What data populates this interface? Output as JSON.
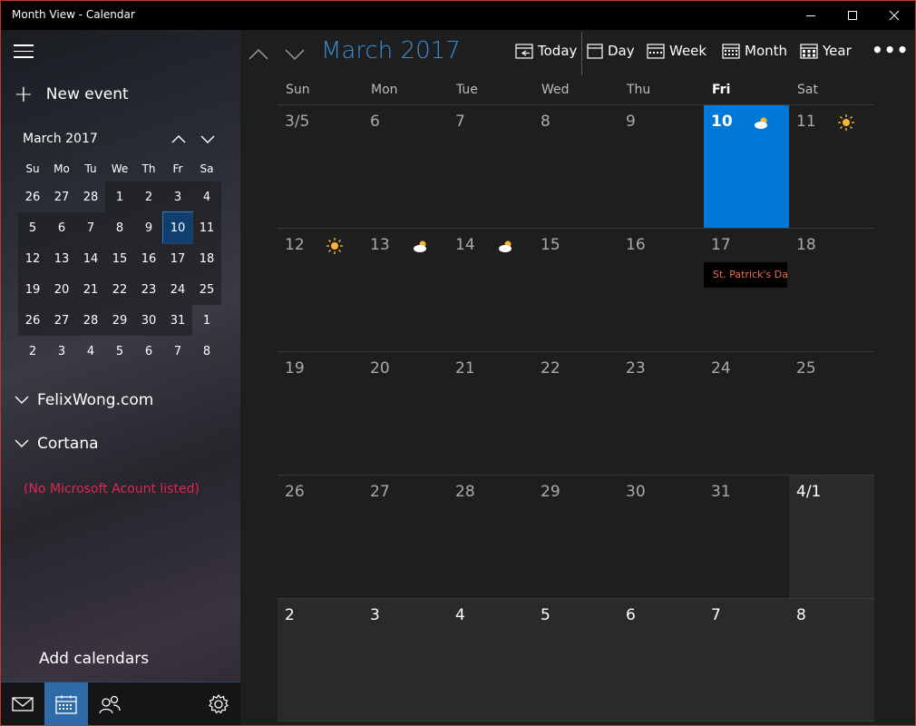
{
  "window": {
    "title": "Month View - Calendar"
  },
  "sidebar": {
    "new_event_label": "New event",
    "mini_month_title": "March 2017",
    "dow": [
      "Su",
      "Mo",
      "Tu",
      "We",
      "Th",
      "Fr",
      "Sa"
    ],
    "weeks": [
      [
        "26",
        "27",
        "28",
        "1",
        "2",
        "3",
        "4"
      ],
      [
        "5",
        "6",
        "7",
        "8",
        "9",
        "10",
        "11"
      ],
      [
        "12",
        "13",
        "14",
        "15",
        "16",
        "17",
        "18"
      ],
      [
        "19",
        "20",
        "21",
        "22",
        "23",
        "24",
        "25"
      ],
      [
        "26",
        "27",
        "28",
        "29",
        "30",
        "31",
        "1"
      ],
      [
        "2",
        "3",
        "4",
        "5",
        "6",
        "7",
        "8"
      ]
    ],
    "accounts": [
      "FelixWong.com",
      "Cortana"
    ],
    "note": "(No Microsoft Acount listed)",
    "add_calendars_label": "Add calendars"
  },
  "toolbar": {
    "month_title": "March 2017",
    "today_label": "Today",
    "day_label": "Day",
    "week_label": "Week",
    "month_label": "Month",
    "year_label": "Year",
    "more_label": "•••"
  },
  "calendar": {
    "dow": [
      "Sun",
      "Mon",
      "Tue",
      "Wed",
      "Thu",
      "Fri",
      "Sat"
    ],
    "weeks": [
      [
        "3/5",
        "6",
        "7",
        "8",
        "9",
        "10",
        "11"
      ],
      [
        "12",
        "13",
        "14",
        "15",
        "16",
        "17",
        "18"
      ],
      [
        "19",
        "20",
        "21",
        "22",
        "23",
        "24",
        "25"
      ],
      [
        "26",
        "27",
        "28",
        "29",
        "30",
        "31",
        "4/1"
      ],
      [
        "2",
        "3",
        "4",
        "5",
        "6",
        "7",
        "8"
      ]
    ],
    "event_label": "St. Patrick's Day",
    "colors": {
      "accent": "#0078d7",
      "title": "#3a8fd6",
      "event_text": "#f36b4e",
      "note": "#e0254f"
    }
  }
}
